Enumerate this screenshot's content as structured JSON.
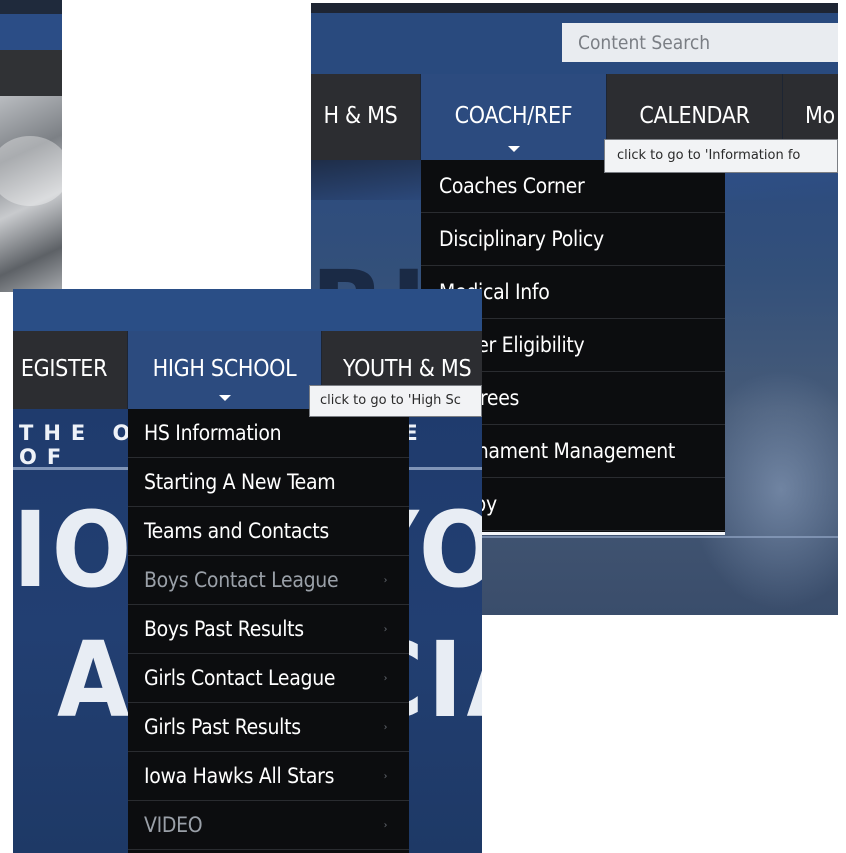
{
  "panel_b": {
    "search": {
      "placeholder": "Content Search"
    },
    "nav": [
      {
        "label": "H & MS"
      },
      {
        "label": "COACH/REF"
      },
      {
        "label": "CALENDAR"
      },
      {
        "label": "Mo"
      }
    ],
    "tooltip": "click to go to 'Information fo",
    "dropdown": [
      {
        "label": "Coaches Corner"
      },
      {
        "label": "Disciplinary Policy"
      },
      {
        "label": "Medical Info"
      },
      {
        "label": "Player Eligibility"
      },
      {
        "label": "Referees"
      },
      {
        "label": "Tournament Management"
      },
      {
        "label": "Rugby"
      }
    ],
    "hero_text": "RUGBY"
  },
  "panel_c": {
    "nav": [
      {
        "label": "EGISTER"
      },
      {
        "label": "HIGH SCHOOL"
      },
      {
        "label": "YOUTH & MS"
      }
    ],
    "tooltip": "click to go to 'High Sc",
    "hero": {
      "tagline": "THE OFFICIAL HOME OF",
      "row1": "IOWA YOUTH RU",
      "row2": "ASSOCIATIO"
    },
    "dropdown": [
      {
        "label": "HS Information",
        "has_submenu": false
      },
      {
        "label": "Starting A New Team",
        "has_submenu": false
      },
      {
        "label": "Teams and Contacts",
        "has_submenu": false
      },
      {
        "label": "Boys Contact League",
        "has_submenu": true,
        "arrow": "›"
      },
      {
        "label": "Boys Past Results",
        "has_submenu": true,
        "arrow": "›"
      },
      {
        "label": "Girls Contact League",
        "has_submenu": true,
        "arrow": "›"
      },
      {
        "label": "Girls Past Results",
        "has_submenu": true,
        "arrow": "›"
      },
      {
        "label": "Iowa Hawks All Stars",
        "has_submenu": true,
        "arrow": "›"
      },
      {
        "label": "VIDEO",
        "has_submenu": true,
        "arrow": "›"
      }
    ]
  },
  "colors": {
    "nav_blue": "#2c4b7f",
    "nav_dark": "#2c2d31",
    "dropdown_bg": "#0c0d0f",
    "dim_text": "#9aa0a8"
  }
}
